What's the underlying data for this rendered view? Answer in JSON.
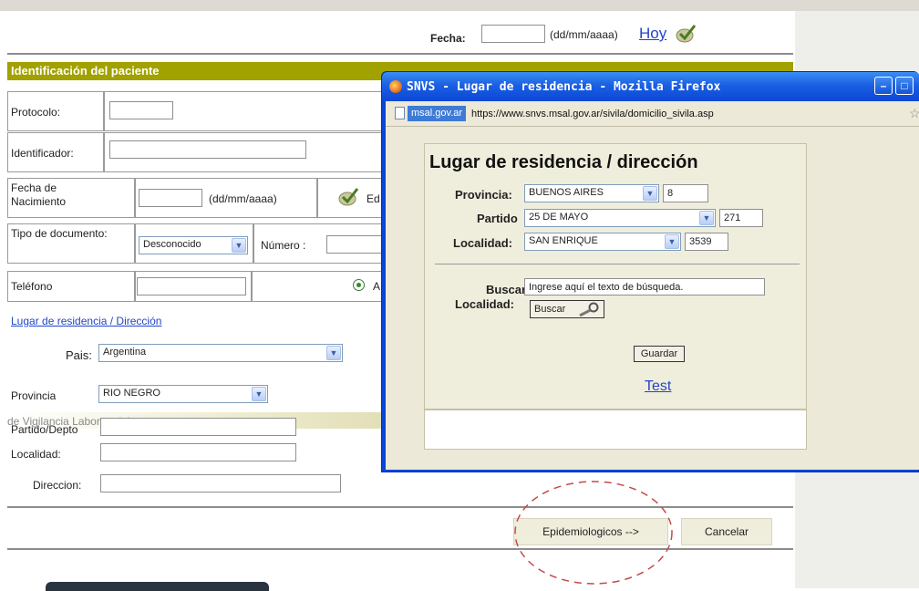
{
  "top_bar": {
    "fecha_label": "Fecha:",
    "fecha_value": "",
    "fecha_format": "(dd/mm/aaaa)",
    "hoy_link": "Hoy"
  },
  "section_title": "Identificación del paciente",
  "form": {
    "protocolo_label": "Protocolo:",
    "identificador_label": "Identificador:",
    "fecha_nacimiento_label": "Fecha de Nacimiento",
    "fecha_nacimiento_format": "(dd/mm/aaaa)",
    "edad_label_partial": "Ed",
    "tipo_documento_label": "Tipo de documento:",
    "tipo_documento_value": "Desconocido",
    "numero_label": "Número :",
    "telefono_label": "Teléfono",
    "radio_partial": "A",
    "residencia_link": "Lugar de residencia / Dirección",
    "pais_label": "Pais:",
    "pais_value": "Argentina",
    "provincia_label": "Provincia",
    "provincia_value": "RIO NEGRO",
    "partido_label": "Partido/Depto",
    "overlap_text": "de Vigilancia Laboratorial",
    "localidad_label": "Localidad:",
    "direccion_label": "Direccion:"
  },
  "buttons": {
    "epidemiologicos": "Epidemiologicos -->",
    "cancelar": "Cancelar"
  },
  "popup": {
    "title": "SNVS - Lugar de residencia - Mozilla Firefox",
    "domain_badge": "msal.gov.ar",
    "url": "https://www.snvs.msal.gov.ar/sivila/domicilio_sivila.asp",
    "heading": "Lugar de residencia / dirección",
    "provincia_label": "Provincia:",
    "provincia_value": "BUENOS AIRES",
    "provincia_code": "8",
    "partido_label": "Partido",
    "partido_value": "25 DE MAYO",
    "partido_code": "271",
    "localidad_label": "Localidad:",
    "localidad_value": "SAN ENRIQUE",
    "localidad_code": "3539",
    "buscar_label": "Buscar",
    "buscar_localidad_label": "Localidad:",
    "buscar_placeholder": "Ingrese aquí el texto de búsqueda.",
    "buscar_button": "Buscar",
    "guardar_button": "Guardar",
    "test_link": "Test"
  },
  "colors": {
    "section_header": "#a1a100",
    "link": "#2046c8",
    "window_title": "#1f63e3",
    "annotation": "#c44a4a"
  }
}
